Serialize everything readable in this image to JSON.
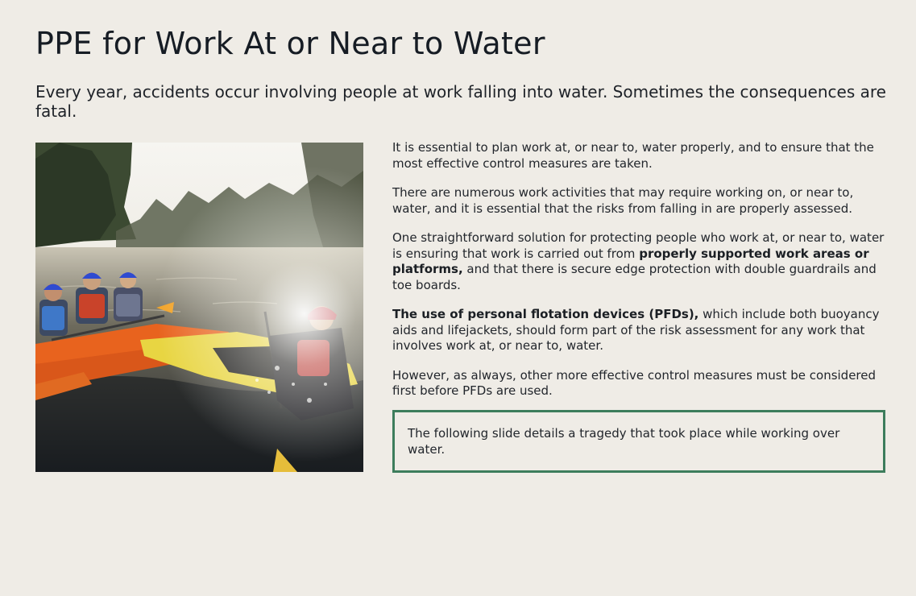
{
  "page": {
    "title": "PPE for Work At or Near to Water",
    "subtitle": "Every year, accidents occur involving people at work falling into water. Sometimes the consequences are fatal."
  },
  "image": {
    "icon": "kayakers-photo"
  },
  "content": {
    "p1": "It is essential to plan work at, or near to, water properly, and to ensure that the most effective control measures are taken.",
    "p2": "There are numerous work activities that may require working on, or near to, water, and it is essential that the risks from falling in are properly assessed.",
    "p3_before": "One straightforward solution for protecting people who work at, or near to, water is ensuring that work is carried out from ",
    "p3_bold": "properly supported work areas or platforms,",
    "p3_after": " and that there is secure edge protection with double guardrails and toe boards.",
    "p4_bold": "The use of personal flotation devices (PFDs),",
    "p4_after": " which include both buoyancy aids and lifejackets, should form part of the risk assessment for any work that involves work at, or near to, water.",
    "p5": "However, as always, other more effective control measures must be considered first before PFDs are used."
  },
  "callout": {
    "text": "The following slide details a tragedy that took place while working over water."
  },
  "colors": {
    "background": "#efece6",
    "callout_border": "#3d7d5c",
    "text": "#1e2228"
  }
}
